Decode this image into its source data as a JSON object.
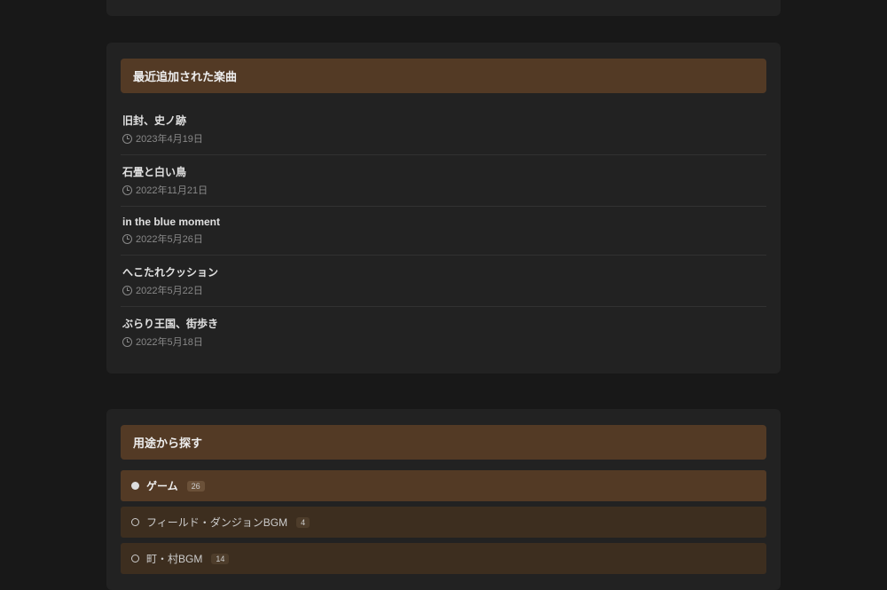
{
  "recent_songs": {
    "header": "最近追加された楽曲",
    "items": [
      {
        "title": "旧封、史ノ跡",
        "date": "2023年4月19日"
      },
      {
        "title": "石畳と白い鳥",
        "date": "2022年11月21日"
      },
      {
        "title": "in the blue moment",
        "date": "2022年5月26日"
      },
      {
        "title": "へこたれクッション",
        "date": "2022年5月22日"
      },
      {
        "title": "ぶらり王国、街歩き",
        "date": "2022年5月18日"
      }
    ]
  },
  "by_usage": {
    "header": "用途から探す",
    "categories": [
      {
        "label": "ゲーム",
        "count": "26",
        "level": "top"
      },
      {
        "label": "フィールド・ダンジョンBGM",
        "count": "4",
        "level": "sub"
      },
      {
        "label": "町・村BGM",
        "count": "14",
        "level": "sub"
      }
    ]
  }
}
